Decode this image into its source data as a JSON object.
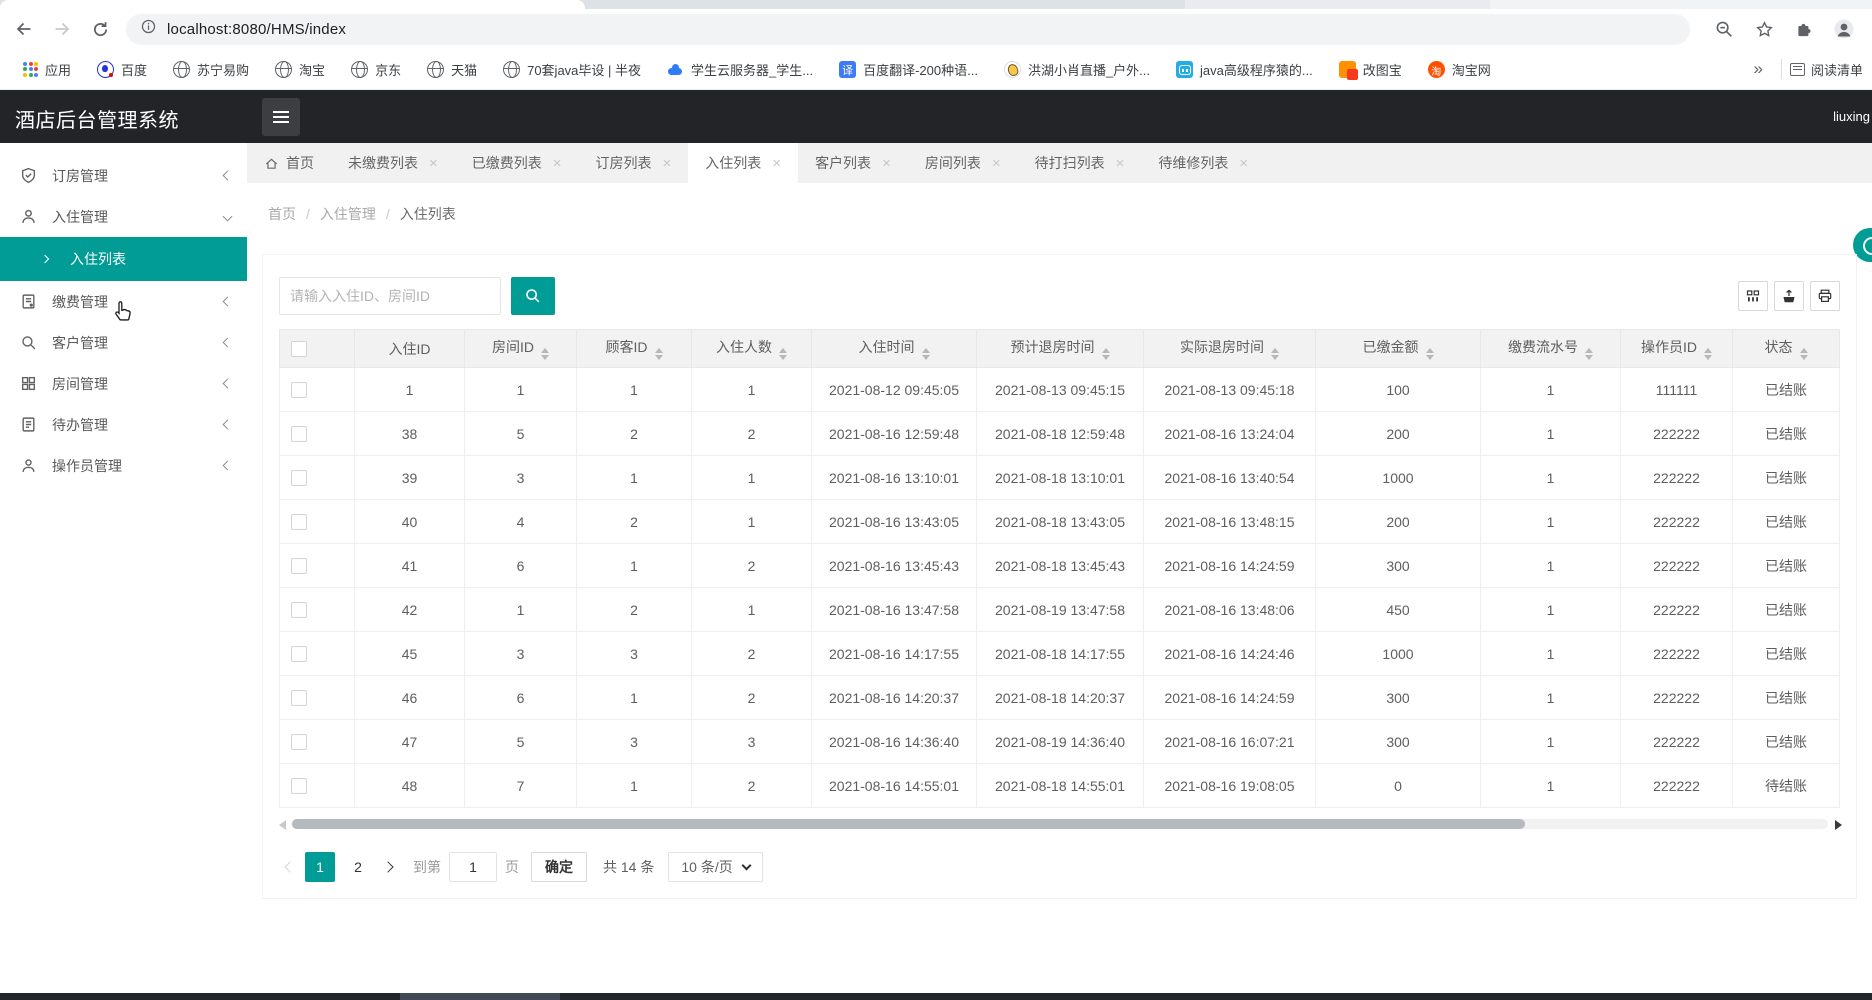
{
  "colors": {
    "accent": "#009C95",
    "header_bg": "#232428"
  },
  "browser": {
    "toolbar": {
      "url": "localhost:8080/HMS/index"
    },
    "bookmarks_bar": {
      "apps_label": "应用",
      "items": [
        {
          "label": "百度",
          "icon": "baidu"
        },
        {
          "label": "苏宁易购",
          "icon": "globe"
        },
        {
          "label": "淘宝",
          "icon": "globe"
        },
        {
          "label": "京东",
          "icon": "globe"
        },
        {
          "label": "天猫",
          "icon": "globe"
        },
        {
          "label": "70套java毕设 | 半夜",
          "icon": "globe"
        },
        {
          "label": "学生云服务器_学生...",
          "icon": "cloud"
        },
        {
          "label": "百度翻译-200种语...",
          "icon": "translate",
          "glyph": "译"
        },
        {
          "label": "洪湖小肖直播_户外...",
          "icon": "bird"
        },
        {
          "label": "java高级程序猿的...",
          "icon": "bili"
        },
        {
          "label": "改图宝",
          "icon": "gaitubao"
        },
        {
          "label": "淘宝网",
          "icon": "taobao",
          "glyph": "淘"
        }
      ],
      "overflow_label": "»",
      "reading_list_label": "阅读清单"
    }
  },
  "app": {
    "header": {
      "title": "酒店后台管理系统",
      "user": "liuxing"
    },
    "sidebar": [
      {
        "label": "订房管理",
        "icon": "shield",
        "state": "collapsed"
      },
      {
        "label": "入住管理",
        "icon": "user",
        "state": "expanded",
        "children": [
          {
            "label": "入住列表",
            "selected": true
          }
        ]
      },
      {
        "label": "缴费管理",
        "icon": "form",
        "state": "collapsed"
      },
      {
        "label": "客户管理",
        "icon": "search",
        "state": "collapsed"
      },
      {
        "label": "房间管理",
        "icon": "grid",
        "state": "collapsed"
      },
      {
        "label": "待办管理",
        "icon": "note",
        "state": "collapsed"
      },
      {
        "label": "操作员管理",
        "icon": "staff",
        "state": "collapsed"
      }
    ],
    "tabs": [
      {
        "label": "首页",
        "icon": "home",
        "closable": false,
        "active": false
      },
      {
        "label": "未缴费列表",
        "closable": true,
        "active": false
      },
      {
        "label": "已缴费列表",
        "closable": true,
        "active": false
      },
      {
        "label": "订房列表",
        "closable": true,
        "active": false
      },
      {
        "label": "入住列表",
        "closable": true,
        "active": true
      },
      {
        "label": "客户列表",
        "closable": true,
        "active": false
      },
      {
        "label": "房间列表",
        "closable": true,
        "active": false
      },
      {
        "label": "待打扫列表",
        "closable": true,
        "active": false
      },
      {
        "label": "待维修列表",
        "closable": true,
        "active": false
      }
    ],
    "breadcrumb": [
      "首页",
      "入住管理",
      "入住列表"
    ],
    "search": {
      "placeholder": "请输入入住ID、房间ID"
    },
    "table": {
      "columns": [
        {
          "label": "",
          "type": "checkbox"
        },
        {
          "label": "入住ID",
          "sortable": false
        },
        {
          "label": "房间ID",
          "sortable": true
        },
        {
          "label": "顾客ID",
          "sortable": true
        },
        {
          "label": "入住人数",
          "sortable": true
        },
        {
          "label": "入住时间",
          "sortable": true
        },
        {
          "label": "预计退房时间",
          "sortable": true
        },
        {
          "label": "实际退房时间",
          "sortable": true
        },
        {
          "label": "已缴金额",
          "sortable": true
        },
        {
          "label": "缴费流水号",
          "sortable": true
        },
        {
          "label": "操作员ID",
          "sortable": true
        },
        {
          "label": "状态",
          "sortable": true
        }
      ],
      "rows": [
        [
          "1",
          "1",
          "1",
          "1",
          "2021-08-12 09:45:05",
          "2021-08-13 09:45:15",
          "2021-08-13 09:45:18",
          "100",
          "1",
          "111111",
          "已结账"
        ],
        [
          "38",
          "5",
          "2",
          "2",
          "2021-08-16 12:59:48",
          "2021-08-18 12:59:48",
          "2021-08-16 13:24:04",
          "200",
          "1",
          "222222",
          "已结账"
        ],
        [
          "39",
          "3",
          "1",
          "1",
          "2021-08-16 13:10:01",
          "2021-08-18 13:10:01",
          "2021-08-16 13:40:54",
          "1000",
          "1",
          "222222",
          "已结账"
        ],
        [
          "40",
          "4",
          "2",
          "1",
          "2021-08-16 13:43:05",
          "2021-08-18 13:43:05",
          "2021-08-16 13:48:15",
          "200",
          "1",
          "222222",
          "已结账"
        ],
        [
          "41",
          "6",
          "1",
          "2",
          "2021-08-16 13:45:43",
          "2021-08-18 13:45:43",
          "2021-08-16 14:24:59",
          "300",
          "1",
          "222222",
          "已结账"
        ],
        [
          "42",
          "1",
          "2",
          "1",
          "2021-08-16 13:47:58",
          "2021-08-19 13:47:58",
          "2021-08-16 13:48:06",
          "450",
          "1",
          "222222",
          "已结账"
        ],
        [
          "45",
          "3",
          "3",
          "2",
          "2021-08-16 14:17:55",
          "2021-08-18 14:17:55",
          "2021-08-16 14:24:46",
          "1000",
          "1",
          "222222",
          "已结账"
        ],
        [
          "46",
          "6",
          "1",
          "2",
          "2021-08-16 14:20:37",
          "2021-08-18 14:20:37",
          "2021-08-16 14:24:59",
          "300",
          "1",
          "222222",
          "已结账"
        ],
        [
          "47",
          "5",
          "3",
          "3",
          "2021-08-16 14:36:40",
          "2021-08-19 14:36:40",
          "2021-08-16 16:07:21",
          "300",
          "1",
          "222222",
          "已结账"
        ],
        [
          "48",
          "7",
          "1",
          "2",
          "2021-08-16 14:55:01",
          "2021-08-18 14:55:01",
          "2021-08-16 19:08:05",
          "0",
          "1",
          "222222",
          "待结账"
        ]
      ]
    },
    "pagination": {
      "pages": [
        "1",
        "2"
      ],
      "active_page": "1",
      "goto_label": "到第",
      "goto_value": "1",
      "page_unit": "页",
      "confirm_label": "确定",
      "total_label": "共 14 条",
      "page_size_label": "10 条/页"
    }
  }
}
